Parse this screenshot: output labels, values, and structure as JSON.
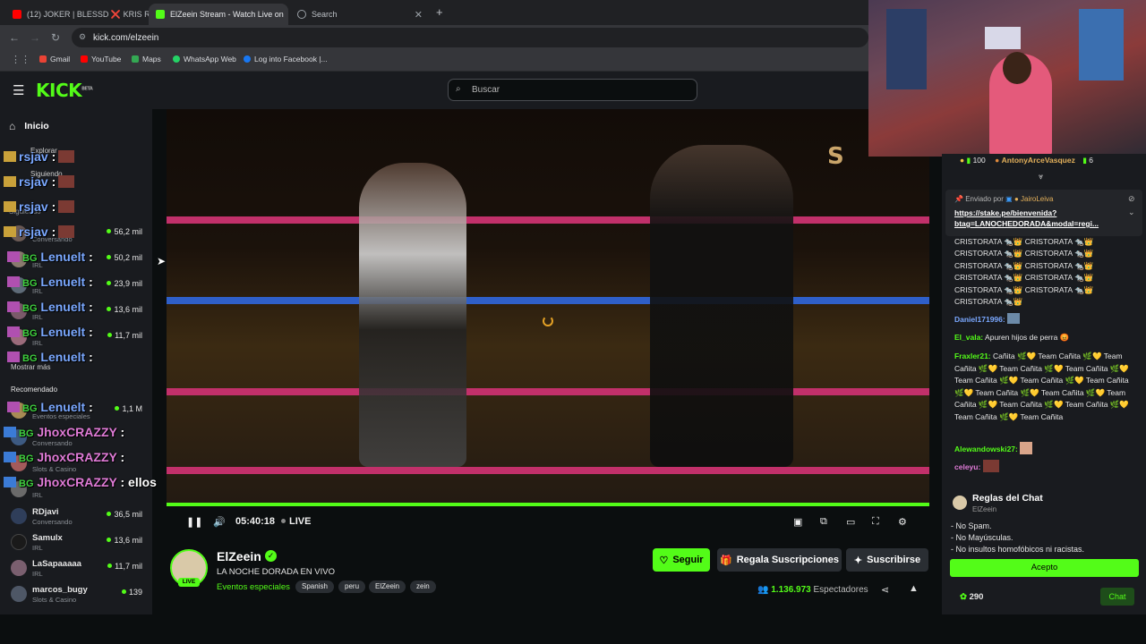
{
  "browser": {
    "tabs": [
      {
        "title": "(12) JOKER | BLESSD ❌ KRIS R",
        "favicon_color": "#ff0000"
      },
      {
        "title": "ElZeein Stream - Watch Live on",
        "favicon_color": "#53fc18"
      },
      {
        "title": "Search",
        "favicon_color": "#9aa0a6"
      }
    ],
    "url": "kick.com/elzeein",
    "bookmarks": [
      "Gmail",
      "YouTube",
      "Maps",
      "WhatsApp Web",
      "Log into Facebook |..."
    ]
  },
  "header": {
    "logo": "KICK",
    "logo_sup": "BETA",
    "search_placeholder": "Buscar"
  },
  "sidebar": {
    "home": "Inicio",
    "section_labels": [
      "Explorar",
      "Siguiendo",
      "Siguiendo",
      "Mostrar más",
      "Recomendado"
    ],
    "channels": [
      {
        "name": "",
        "category": "Conversando",
        "viewers": "56,2 mil"
      },
      {
        "name": "",
        "category": "IRL",
        "viewers": "50,2 mil"
      },
      {
        "name": "",
        "category": "IRL",
        "viewers": "23,9 mil"
      },
      {
        "name": "",
        "category": "IRL",
        "viewers": "13,6 mil"
      },
      {
        "name": "",
        "category": "IRL",
        "viewers": "11,7 mil"
      },
      {
        "name": "",
        "category": "Eventos especiales",
        "viewers": "1,1 M"
      },
      {
        "name": "",
        "category": "Conversando",
        "viewers": ""
      },
      {
        "name": "",
        "category": "Slots & Casino",
        "viewers": ""
      },
      {
        "name": "",
        "category": "IRL",
        "viewers": ""
      },
      {
        "name": "RDjavi",
        "category": "Conversando",
        "viewers": "36,5 mil"
      },
      {
        "name": "Samulx",
        "category": "IRL",
        "viewers": "13,6 mil"
      },
      {
        "name": "LaSapaaaaa",
        "category": "IRL",
        "viewers": "11,7 mil"
      },
      {
        "name": "marcos_bugy",
        "category": "Slots & Casino",
        "viewers": "139"
      }
    ]
  },
  "overlay_chat": [
    {
      "user": "rsjav",
      "text": ":"
    },
    {
      "user": "rsjav",
      "text": ":"
    },
    {
      "user": "rsjav",
      "text": ":"
    },
    {
      "user": "rsjav",
      "text": ":"
    },
    {
      "user": "Lenuelt",
      "text": ":"
    },
    {
      "user": "Lenuelt",
      "text": ":"
    },
    {
      "user": "Lenuelt",
      "text": ":"
    },
    {
      "user": "Lenuelt",
      "text": ":"
    },
    {
      "user": "Lenuelt",
      "text": ":"
    },
    {
      "user": "Lenuelt",
      "text": ":"
    },
    {
      "user": "JhoxCRAZZY",
      "text": ":"
    },
    {
      "user": "JhoxCRAZZY",
      "text": ":"
    },
    {
      "user": "JhoxCRAZZY",
      "text": ": ellos"
    }
  ],
  "video": {
    "time": "05:40:18",
    "live_label": "LIVE",
    "progress": 1.0
  },
  "stream": {
    "name": "ElZeein",
    "title": "LA NOCHE DORADA EN VIVO",
    "category": "Eventos especiales",
    "tags": [
      "Spanish",
      "peru",
      "ElZeein",
      "zein"
    ],
    "live_badge": "LIVE",
    "follow_label": "Seguir",
    "gift_label": "Regala Suscripciones",
    "subscribe_label": "Suscribirse",
    "viewer_count": "1.136.973",
    "viewer_label": "Espectadores"
  },
  "chat": {
    "top_gift": {
      "amount": "100",
      "user": "AntonyArceVasquez",
      "count": "6"
    },
    "pinned": {
      "label": "Enviado por",
      "user": "JairoLeiva",
      "link_line1": "https://stake.pe/bienvenida?",
      "link_line2": "btag=LANOCHEDORADA&modal=regi..."
    },
    "messages": [
      {
        "user": "",
        "text": "CRISTORATA 🐀👑 CRISTORATA 🐀👑",
        "color": "#e6e6e6"
      },
      {
        "user": "",
        "text": "CRISTORATA 🐀👑 CRISTORATA 🐀👑",
        "color": "#e6e6e6"
      },
      {
        "user": "",
        "text": "CRISTORATA 🐀👑 CRISTORATA 🐀👑",
        "color": "#e6e6e6"
      },
      {
        "user": "",
        "text": "CRISTORATA 🐀👑 CRISTORATA 🐀👑",
        "color": "#e6e6e6"
      },
      {
        "user": "",
        "text": "CRISTORATA 🐀👑 CRISTORATA 🐀👑",
        "color": "#e6e6e6"
      },
      {
        "user": "",
        "text": "CRISTORATA 🐀👑",
        "color": "#e6e6e6"
      },
      {
        "user": "Daniel171996:",
        "text": "",
        "color": "#7aa8ff"
      },
      {
        "user": "El_vala:",
        "text": "Apuren hijos de perra 😡",
        "color": "#53fc18"
      },
      {
        "user": "Fraxler21:",
        "text": "Cañita 🌿💛 Team Cañita 🌿💛 Team Cañita 🌿💛 Team Cañita 🌿💛 Team Cañita 🌿💛 Team Cañita 🌿💛 Team Cañita 🌿💛 Team Cañita 🌿💛 Team Cañita 🌿💛 Team Cañita 🌿💛 Team Cañita 🌿💛 Team Cañita 🌿💛 Team Cañita 🌿💛 Team Cañita 🌿💛 Team Cañita",
        "color": "#53fc18"
      },
      {
        "user": "Alewandowski27:",
        "text": "",
        "color": "#53fc18"
      },
      {
        "user": "celeyu:",
        "text": "",
        "color": "#e07bd7"
      }
    ],
    "rules": {
      "title": "Reglas del Chat",
      "owner": "ElZeein",
      "items": [
        "- No Spam.",
        "- No Mayúsculas.",
        "- No insultos homofóbicos ni racistas."
      ],
      "accept_label": "Acepto"
    },
    "points": "290",
    "chat_button": "Chat"
  },
  "colors": {
    "kick_green": "#53fc18",
    "bg": "#0b0e0f",
    "panel": "#191b1f"
  }
}
